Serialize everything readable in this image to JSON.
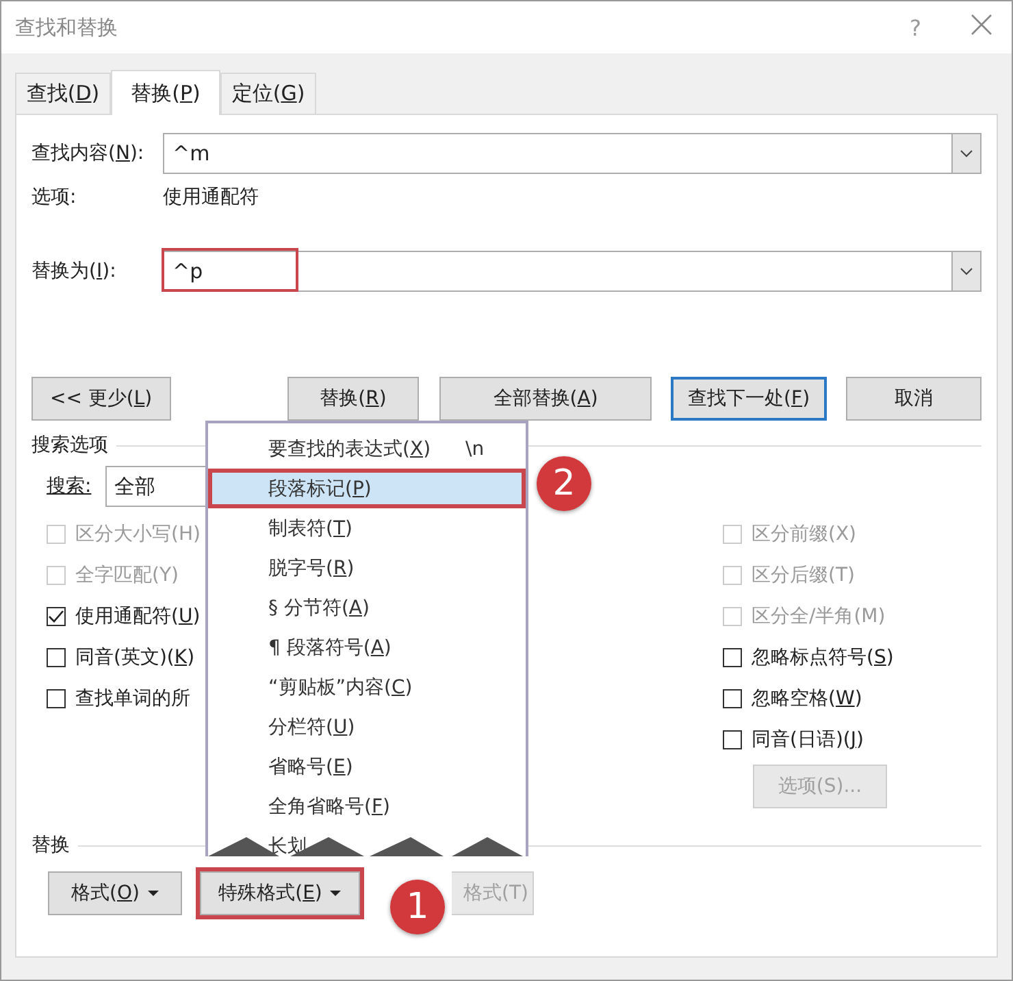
{
  "window": {
    "title": "查找和替换",
    "help": "?"
  },
  "tabs": [
    {
      "label": "查找(D)",
      "selected": false
    },
    {
      "label": "替换(P)",
      "selected": true
    },
    {
      "label": "定位(G)",
      "selected": false
    }
  ],
  "find": {
    "label": "查找内容(N):",
    "value": "^m"
  },
  "options": {
    "label": "选项:",
    "value": "使用通配符"
  },
  "replace": {
    "label": "替换为(I):",
    "value": "^p",
    "highlighted": true
  },
  "buttons": [
    {
      "label": "<< 更少(L)",
      "default": false
    },
    {
      "label": "替换(R)",
      "default": false
    },
    {
      "label": "全部替换(A)",
      "default": false
    },
    {
      "label": "查找下一处(F)",
      "default": true
    },
    {
      "label": "取消",
      "default": false
    }
  ],
  "search_options": {
    "title": "搜索选项",
    "search_label": "搜索:",
    "search_value": "全部"
  },
  "left_checkboxes": [
    {
      "label": "区分大小写(H)",
      "checked": false,
      "disabled": true
    },
    {
      "label": "全字匹配(Y)",
      "checked": false,
      "disabled": true
    },
    {
      "label": "使用通配符(U)",
      "checked": true,
      "disabled": false
    },
    {
      "label": "同音(英文)(K)",
      "checked": false,
      "disabled": false
    },
    {
      "label": "查找单词的所",
      "checked": false,
      "disabled": false
    }
  ],
  "right_checkboxes": [
    {
      "label": "区分前缀(X)",
      "checked": false,
      "disabled": true
    },
    {
      "label": "区分后缀(T)",
      "checked": false,
      "disabled": true
    },
    {
      "label": "区分全/半角(M)",
      "checked": false,
      "disabled": true
    },
    {
      "label": "忽略标点符号(S)",
      "checked": false,
      "disabled": false
    },
    {
      "label": "忽略空格(W)",
      "checked": false,
      "disabled": false
    },
    {
      "label": "同音(日语)(J)",
      "checked": false,
      "disabled": false
    }
  ],
  "options_button": {
    "label": "选项(S)...",
    "disabled": true
  },
  "replace_section": {
    "title": "替换",
    "buttons": [
      {
        "label": "格式(O)",
        "dropdown": true,
        "disabled": false,
        "highlighted": false
      },
      {
        "label": "特殊格式(E)",
        "dropdown": true,
        "disabled": false,
        "highlighted": true
      },
      {
        "label": "格式(T)",
        "dropdown": false,
        "disabled": true,
        "highlighted": false
      }
    ]
  },
  "menu": {
    "items": [
      {
        "label": "要查找的表达式(X)",
        "shortcut": "\\n",
        "selected": false,
        "highlighted": false
      },
      {
        "label": "段落标记(P)",
        "selected": true,
        "highlighted": true
      },
      {
        "label": "制表符(T)",
        "selected": false,
        "highlighted": false
      },
      {
        "label": "脱字号(R)",
        "selected": false,
        "highlighted": false
      },
      {
        "label": "§ 分节符(A)",
        "selected": false,
        "highlighted": false
      },
      {
        "label": "¶ 段落符号(A)",
        "selected": false,
        "highlighted": false
      },
      {
        "label": "“剪贴板”内容(C)",
        "selected": false,
        "highlighted": false
      },
      {
        "label": "分栏符(U)",
        "selected": false,
        "highlighted": false
      },
      {
        "label": "省略号(E)",
        "selected": false,
        "highlighted": false
      },
      {
        "label": "全角省略号(F)",
        "selected": false,
        "highlighted": false
      },
      {
        "label": "长划",
        "selected": false,
        "highlighted": false
      }
    ]
  },
  "step_badges": [
    {
      "label": "1"
    },
    {
      "label": "2"
    }
  ]
}
